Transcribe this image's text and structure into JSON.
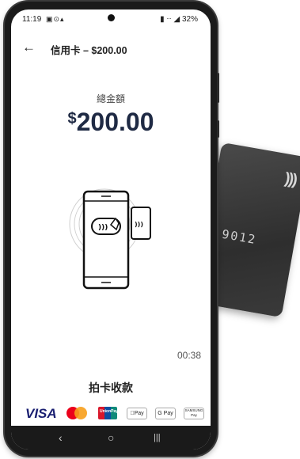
{
  "status_bar": {
    "time": "11:19",
    "left_icons": "▣⊙▴",
    "right": "▮ ⋅⋅ ◢ 32%"
  },
  "header": {
    "title": "信用卡 – $200.00"
  },
  "payment": {
    "total_label": "總金額",
    "currency_symbol": "$",
    "amount": "200.00"
  },
  "timer": "00:38",
  "instruction": "拍卡收款",
  "card": {
    "digits": "9012",
    "nfc_symbol": "))))"
  },
  "logos": {
    "visa": "VISA",
    "unionpay": "UnionPay",
    "apple_pay": "Pay",
    "google_pay": "G Pay",
    "samsung_pay": "SAMSUNG Pay"
  },
  "navbar": {
    "back": "‹",
    "home": "○",
    "recents": "|||"
  },
  "colors": {
    "amount": "#1f2a44",
    "visa": "#1a1f71"
  }
}
